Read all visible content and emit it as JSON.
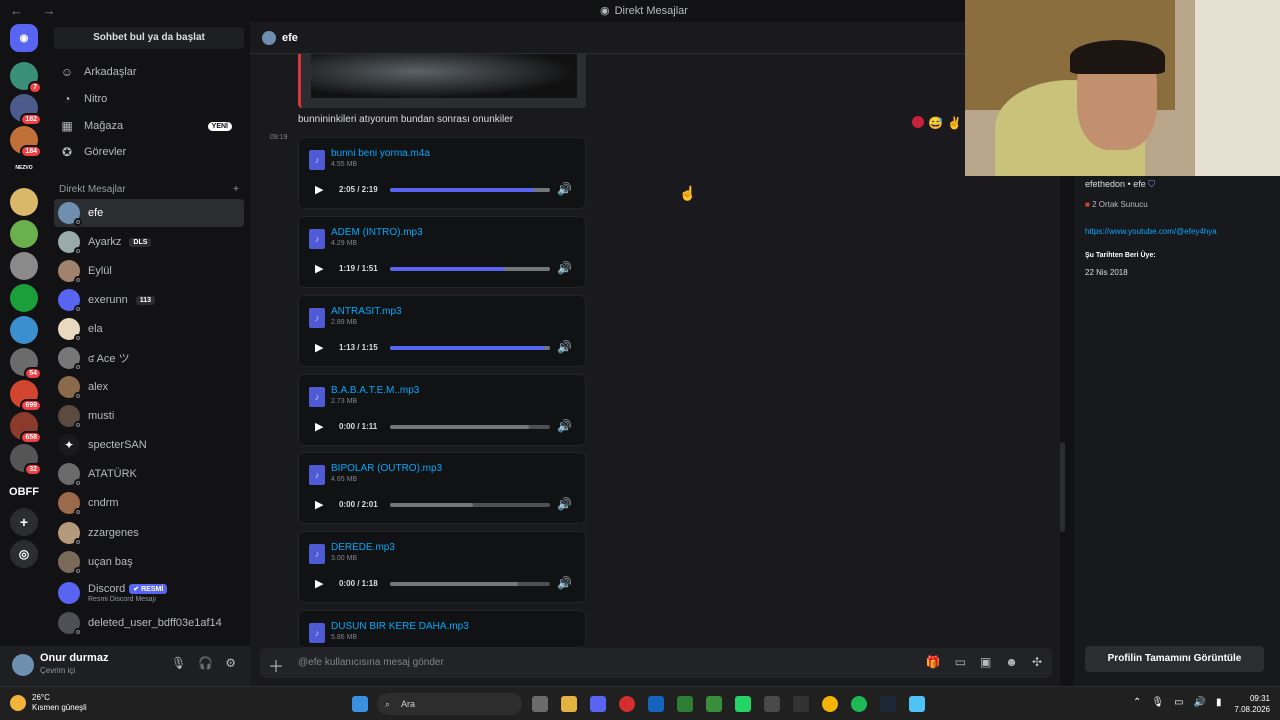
{
  "window": {
    "title": "Direkt Mesajlar",
    "nav": "← →"
  },
  "sidebar": {
    "search": "Sohbet bul ya da başlat",
    "nav": [
      {
        "label": "Arkadaşlar",
        "icon": "friends-icon"
      },
      {
        "label": "Nitro",
        "icon": "nitro-icon"
      },
      {
        "label": "Mağaza",
        "icon": "shop-icon",
        "badge": "YENİ"
      },
      {
        "label": "Görevler",
        "icon": "quests-icon"
      }
    ],
    "dm_header": "Direkt Mesajlar",
    "dm_add": "+",
    "dms": [
      {
        "name": "efe"
      },
      {
        "name": "Ayarkz",
        "tag": "DLS"
      },
      {
        "name": "Eylül"
      },
      {
        "name": "exerunn",
        "tag": "113"
      },
      {
        "name": "ela"
      },
      {
        "name": "ʛ Ace ツ"
      },
      {
        "name": "alex"
      },
      {
        "name": "musti"
      },
      {
        "name": "specterSAN"
      },
      {
        "name": "ATATÜRK"
      },
      {
        "name": "cndrm"
      },
      {
        "name": "zzargenes"
      },
      {
        "name": "uçan baş"
      },
      {
        "name": "Discord",
        "tag": "✔ RESMİ",
        "sub": "Resmi Discord Mesajı"
      },
      {
        "name": "deleted_user_bdff03e1af14"
      }
    ]
  },
  "servers": {
    "badges": [
      "7",
      "182",
      "184",
      "54",
      "699",
      "658",
      "32"
    ],
    "text_label": "OBFF",
    "mini_label": "NEZVO"
  },
  "user": {
    "name": "Onur durmaz",
    "status": "Çevrim içi"
  },
  "chat": {
    "header": "efe",
    "prev_message": "bunnininkileri atıyorum bundan sonrası onunkiler",
    "timestamp": "09:19",
    "attachments": [
      {
        "name": "bunni beni yorma.m4a",
        "size": "4.55 MB",
        "time": "2:05 / 2:19",
        "progress": 0.9,
        "buffered": 1.0
      },
      {
        "name": "ADEM (INTRO).mp3",
        "size": "4.29 MB",
        "time": "1:19 / 1:51",
        "progress": 0.71,
        "buffered": 1.0
      },
      {
        "name": "ANTRASIT.mp3",
        "size": "2.89 MB",
        "time": "1:13 / 1:15",
        "progress": 0.97,
        "buffered": 1.0
      },
      {
        "name": "B.A.B.A.T.E.M..mp3",
        "size": "2.73 MB",
        "time": "0:00 / 1:11",
        "progress": 0.0,
        "buffered": 0.87
      },
      {
        "name": "BIPOLAR (OUTRO).mp3",
        "size": "4.65 MB",
        "time": "0:00 / 2:01",
        "progress": 0.0,
        "buffered": 0.52
      },
      {
        "name": "DEREDE.mp3",
        "size": "3.00 MB",
        "time": "0:00 / 1:18",
        "progress": 0.0,
        "buffered": 0.8
      },
      {
        "name": "DUSUN BIR KERE DAHA.mp3",
        "size": "5.86 MB",
        "time": "",
        "progress": 0.0,
        "buffered": 0.0
      }
    ],
    "composer_placeholder": "@efe kullanıcısına mesaj gönder"
  },
  "profile": {
    "username_line": "efethedon • efe",
    "mutual": "2 Ortak Sunucu",
    "link": "https://www.youtube.com/@efey4hya",
    "member_since_label": "Şu Tarihten Beri Üye:",
    "member_since": "22 Nis 2018",
    "full_profile_button": "Profilin Tamamını Görüntüle"
  },
  "taskbar": {
    "weather_temp": "26°C",
    "weather_desc": "Kısmen güneşli",
    "search": "Ara",
    "time": "09:31",
    "date": "7.08.2026"
  },
  "colors": {
    "accent": "#5865f2",
    "link": "#00a8fc",
    "danger": "#da373c"
  }
}
